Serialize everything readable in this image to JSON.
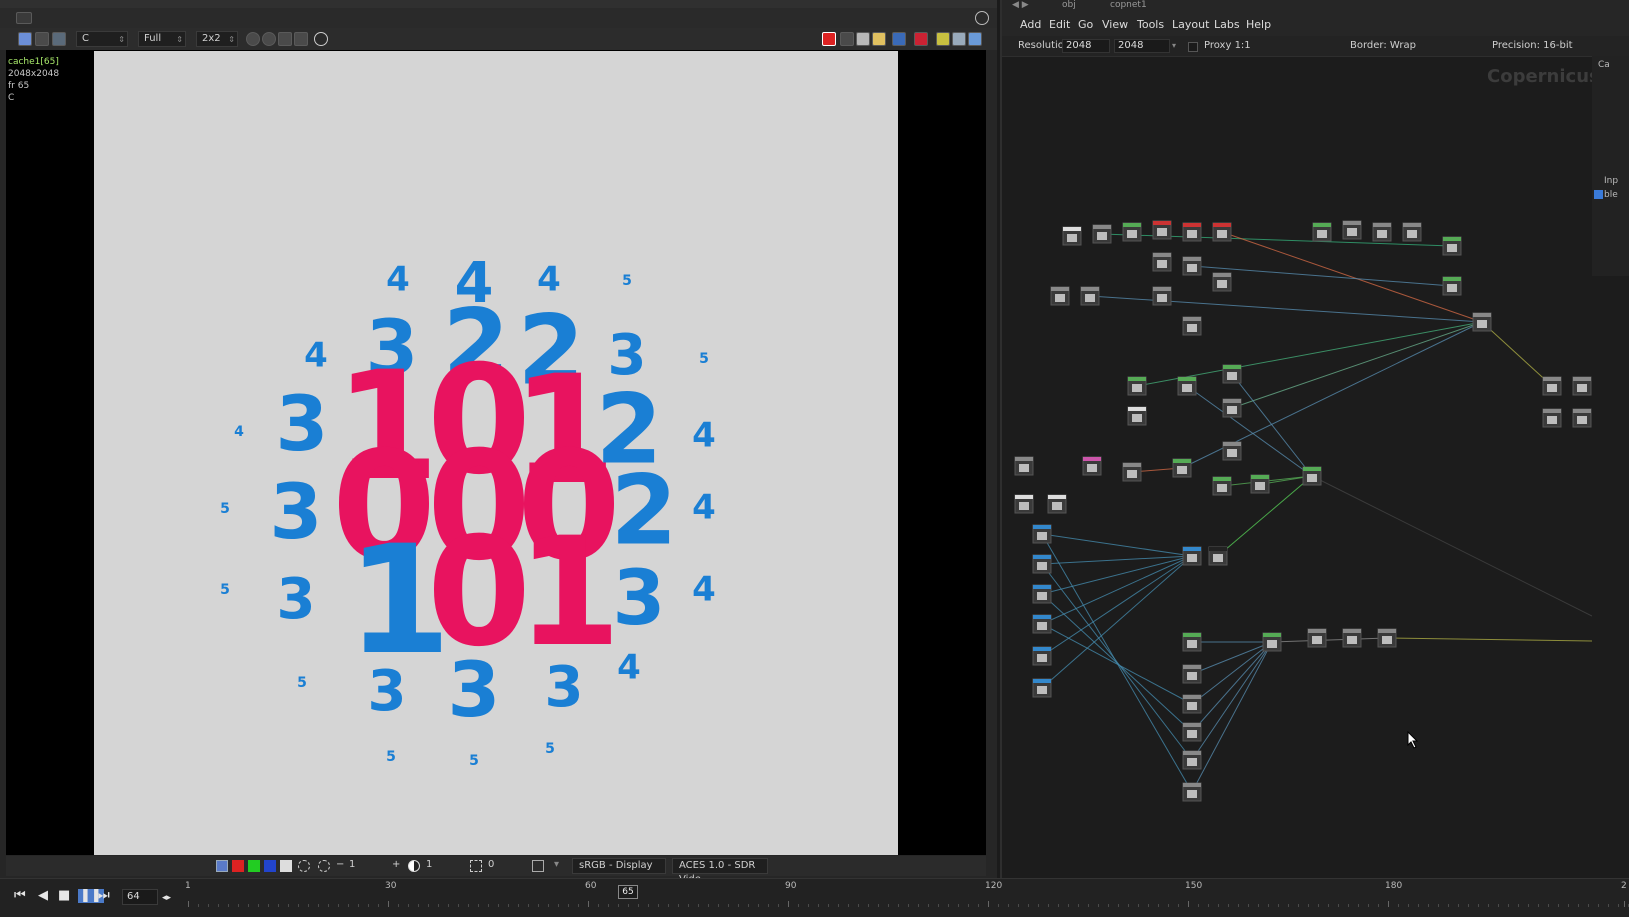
{
  "viewer": {
    "toolbar": {
      "channel": "C",
      "resolution": "Full",
      "sampling": "2x2"
    },
    "cache_info": {
      "name": "cache1[65]",
      "size": "2048x2048",
      "frame": "fr 65",
      "channel": "C"
    },
    "image": {
      "background": "#d5d5d5",
      "blue": "#1a7fd4",
      "pink": "#e8135f",
      "digits": [
        {
          "t": "4",
          "c": "blue",
          "s": "sm"
        },
        {
          "t": "4",
          "c": "blue",
          "s": "md"
        },
        {
          "t": "4",
          "c": "blue",
          "s": "sm"
        },
        {
          "t": "5",
          "c": "blue",
          "s": "xs"
        },
        {
          "t": "4",
          "c": "blue",
          "s": "sm"
        },
        {
          "t": "3",
          "c": "blue",
          "s": "lg"
        },
        {
          "t": "2",
          "c": "blue",
          "s": "xl"
        },
        {
          "t": "2",
          "c": "blue",
          "s": "xl"
        },
        {
          "t": "3",
          "c": "blue",
          "s": "md"
        },
        {
          "t": "5",
          "c": "blue",
          "s": "xs"
        },
        {
          "t": "4",
          "c": "blue",
          "s": "xs"
        },
        {
          "t": "3",
          "c": "blue",
          "s": "lg"
        },
        {
          "t": "1",
          "c": "pink",
          "s": "xxl"
        },
        {
          "t": "0",
          "c": "pink",
          "s": "xxl"
        },
        {
          "t": "1",
          "c": "pink",
          "s": "xxl"
        },
        {
          "t": "2",
          "c": "blue",
          "s": "xl"
        },
        {
          "t": "4",
          "c": "blue",
          "s": "sm"
        },
        {
          "t": "5",
          "c": "blue",
          "s": "xs"
        },
        {
          "t": "3",
          "c": "blue",
          "s": "lg"
        },
        {
          "t": "0",
          "c": "pink",
          "s": "xxl"
        },
        {
          "t": "0",
          "c": "pink",
          "s": "xxl"
        },
        {
          "t": "0",
          "c": "pink",
          "s": "xxl"
        },
        {
          "t": "2",
          "c": "blue",
          "s": "xl"
        },
        {
          "t": "4",
          "c": "blue",
          "s": "sm"
        },
        {
          "t": "5",
          "c": "blue",
          "s": "xs"
        },
        {
          "t": "3",
          "c": "blue",
          "s": "md"
        },
        {
          "t": "1",
          "c": "blue",
          "s": "xxl"
        },
        {
          "t": "0",
          "c": "pink",
          "s": "xxl"
        },
        {
          "t": "1",
          "c": "pink",
          "s": "xxl"
        },
        {
          "t": "3",
          "c": "blue",
          "s": "lg"
        },
        {
          "t": "4",
          "c": "blue",
          "s": "sm"
        },
        {
          "t": "5",
          "c": "blue",
          "s": "xs"
        },
        {
          "t": "3",
          "c": "blue",
          "s": "md"
        },
        {
          "t": "3",
          "c": "blue",
          "s": "lg"
        },
        {
          "t": "3",
          "c": "blue",
          "s": "md"
        },
        {
          "t": "4",
          "c": "blue",
          "s": "sm"
        },
        {
          "t": "5",
          "c": "blue",
          "s": "xs"
        },
        {
          "t": "5",
          "c": "blue",
          "s": "xs"
        },
        {
          "t": "5",
          "c": "blue",
          "s": "xs"
        }
      ]
    },
    "bottom_bar": {
      "exposure_value": "1",
      "gamma_value": "1",
      "offset_value": "0",
      "display": "sRGB - Display",
      "view": "ACES 1.0 - SDR Vide"
    }
  },
  "timeline": {
    "current_frame_field": "64",
    "playhead_frame": "65",
    "tick_labels": [
      "1",
      "30",
      "60",
      "90",
      "120",
      "150",
      "180",
      "2"
    ]
  },
  "network": {
    "menu": [
      "Add",
      "Edit",
      "Go",
      "View",
      "Tools",
      "Layout",
      "Labs",
      "Help"
    ],
    "params": {
      "resolution_label": "Resolution",
      "res_x": "2048",
      "res_y": "2048",
      "proxy": "Proxy 1:1",
      "border": "Border: Wrap",
      "precision": "Precision: 16-bit"
    },
    "context_title": "Copernicus",
    "side_labels": [
      "Ca",
      "Inp",
      "ble"
    ],
    "path": {
      "obj": "obj",
      "node": "copnet1"
    }
  }
}
